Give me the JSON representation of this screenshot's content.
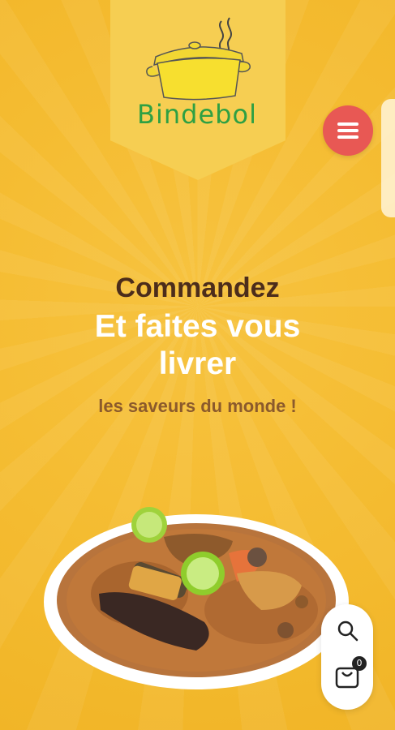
{
  "brand": {
    "name": "Bindebol"
  },
  "hero": {
    "title": "Commandez",
    "subtitle_line1": "Et faites vous",
    "subtitle_line2": "livrer",
    "tagline": "les saveurs du monde !"
  },
  "floating_actions": {
    "search_icon": "search-icon",
    "cart_icon": "shopping-bag-icon",
    "cart_count": "0"
  },
  "menu": {
    "icon": "hamburger-icon"
  },
  "colors": {
    "background": "#f5bd33",
    "banner": "#f6ce52",
    "title": "#4c2d1b",
    "tagline": "#8b5a2c",
    "menu_button": "#e85854",
    "brand_text": "#2ea043"
  }
}
